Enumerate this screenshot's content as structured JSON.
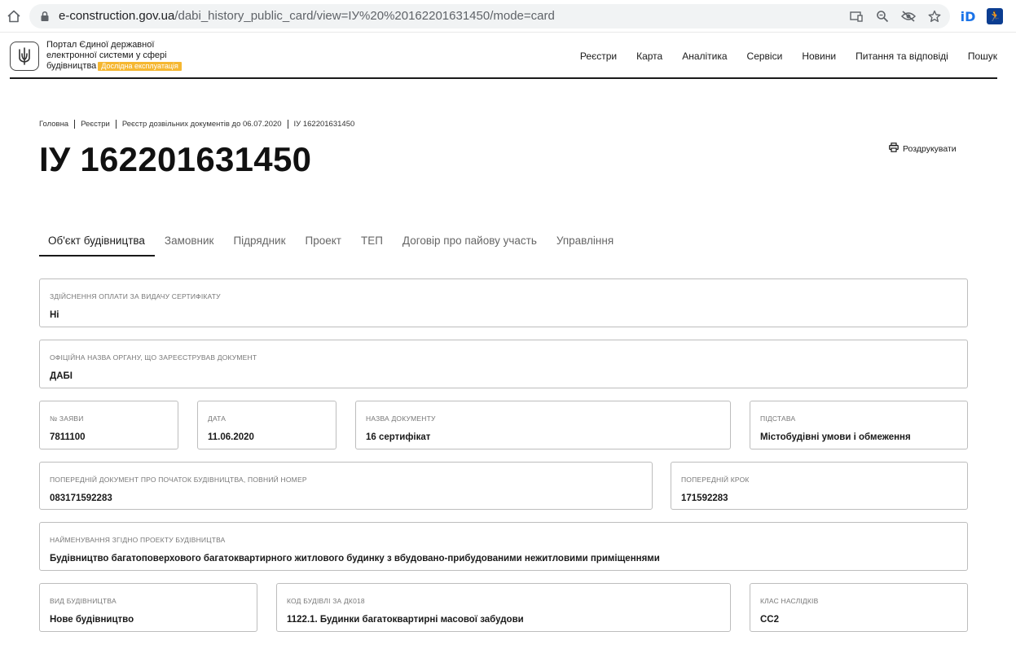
{
  "browser": {
    "url_domain": "e-construction.gov.ua",
    "url_path": "/dabi_history_public_card/view=ІУ%20%20162201631450/mode=card",
    "ext_id_label": "iD",
    "ext_run_label": "🏃"
  },
  "header": {
    "logo_line1": "Портал Єдиної державної",
    "logo_line2": "електронної системи у сфері",
    "logo_line3": "будівництва",
    "beta_badge": "Дослідна експлуатація",
    "nav": [
      "Реєстри",
      "Карта",
      "Аналітика",
      "Сервіси",
      "Новини",
      "Питання та відповіді",
      "Пошук"
    ]
  },
  "breadcrumb": [
    "Головна",
    "Реєстри",
    "Реєстр дозвільних документів до 06.07.2020",
    "ІУ 162201631450"
  ],
  "page_title": "ІУ 162201631450",
  "print_label": "Роздрукувати",
  "tabs": [
    "Об'єкт будівництва",
    "Замовник",
    "Підрядник",
    "Проект",
    "ТЕП",
    "Договір про пайову участь",
    "Управління"
  ],
  "fields": {
    "payment": {
      "label": "Здійснення оплати за видачу сертифікату",
      "value": "Ні"
    },
    "authority": {
      "label": "Офіційна назва органу, що зареєстрував документ",
      "value": "ДАБІ"
    },
    "application_no": {
      "label": "№ заяви",
      "value": "7811100"
    },
    "date": {
      "label": "Дата",
      "value": "11.06.2020"
    },
    "doc_name": {
      "label": "Назва документу",
      "value": "16 сертифікат"
    },
    "basis": {
      "label": "Підстава",
      "value": "Містобудівні умови і обмеження"
    },
    "prev_doc": {
      "label": "Попередній документ про початок будівництва, повний номер",
      "value": "083171592283"
    },
    "prev_step": {
      "label": "Попередній крок",
      "value": "171592283"
    },
    "project_name": {
      "label": "Найменування згідно проекту будівництва",
      "value": "Будівництво багатоповерхового багатоквартирного житлового будинку з вбудовано-прибудованими нежитловими приміщеннями"
    },
    "construction_type": {
      "label": "Вид будівництва",
      "value": "Нове будівництво"
    },
    "building_code": {
      "label": "Код будівлі за ДК018",
      "value": "1122.1. Будинки багатоквартирні масової забудови"
    },
    "consequence_class": {
      "label": "Клас наслідків",
      "value": "СС2"
    }
  }
}
